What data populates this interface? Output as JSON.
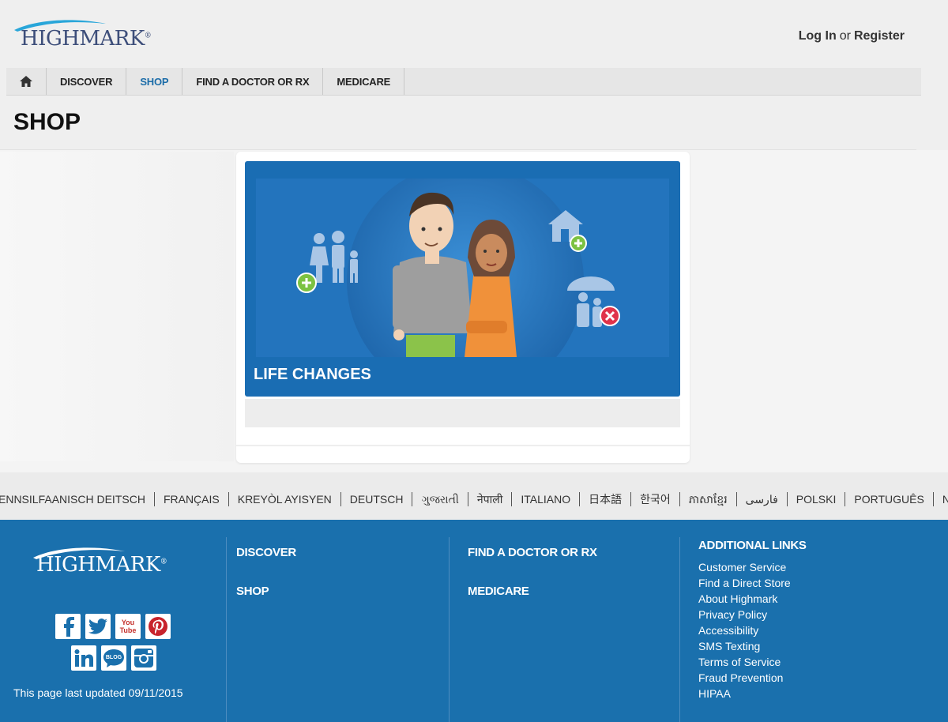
{
  "header": {
    "logo_text": "HIGHMARK",
    "login_label": "Log In",
    "or_label": "or",
    "register_label": "Register"
  },
  "nav": {
    "home_icon": "home-icon",
    "items": [
      "DISCOVER",
      "SHOP",
      "FIND A DOCTOR OR RX",
      "MEDICARE"
    ],
    "active": "SHOP"
  },
  "page": {
    "title": "SHOP"
  },
  "card": {
    "label": "LIFE CHANGES"
  },
  "languages": [
    "ENNSILFAANISCH DEITSCH",
    "FRANÇAIS",
    "KREYÒL AYISYEN",
    "DEUTSCH",
    "ગુજરાતી",
    "नेपाली",
    "ITALIANO",
    "日本語",
    "한국어",
    "ភាសាខ្មែរ",
    "فارسی",
    "POLSKI",
    "PORTUGUÊS",
    "NON-DISCRIMI"
  ],
  "footer": {
    "logo_text": "HIGHMARK",
    "social_icons": [
      "facebook-icon",
      "twitter-icon",
      "youtube-icon",
      "pinterest-icon",
      "linkedin-icon",
      "blog-icon",
      "instagram-icon"
    ],
    "youtube_text": "You Tube",
    "blog_text": "BLOG",
    "updated": "This page last updated 09/11/2015",
    "col1": [
      "DISCOVER",
      "SHOP"
    ],
    "col2": [
      "FIND A DOCTOR OR RX",
      "MEDICARE"
    ],
    "additional_title": "ADDITIONAL LINKS",
    "additional_links": [
      "Customer Service",
      "Find a Direct Store",
      "About Highmark",
      "Privacy Policy",
      "Accessibility",
      "SMS Texting",
      "Terms of Service",
      "Fraud Prevention",
      "HIPAA"
    ]
  },
  "colors": {
    "brand_blue": "#1a70ad",
    "nav_active": "#1b6ca8",
    "card_blue": "#1a6db3"
  }
}
